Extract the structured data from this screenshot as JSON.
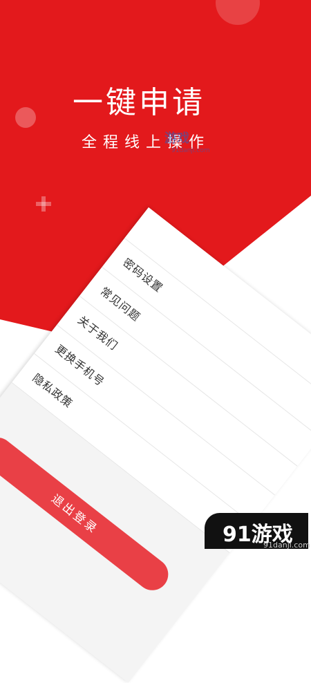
{
  "hero": {
    "title": "一键申请",
    "subtitle": "全程线上操作"
  },
  "watermark_top": {
    "text": "游戏",
    "url": "91danji.com"
  },
  "menu": {
    "items": [
      {
        "label": ""
      },
      {
        "label": "密码设置"
      },
      {
        "label": "常见问题"
      },
      {
        "label": "关于我们"
      },
      {
        "label": "更换手机号"
      },
      {
        "label": "隐私政策"
      }
    ]
  },
  "logout": {
    "label": "退出登录"
  },
  "watermark_bottom": {
    "text": "91游戏",
    "url": "91danji.com"
  },
  "colors": {
    "brand_red": "#e3191c",
    "button_red": "#e94046",
    "background": "#ffffff"
  }
}
